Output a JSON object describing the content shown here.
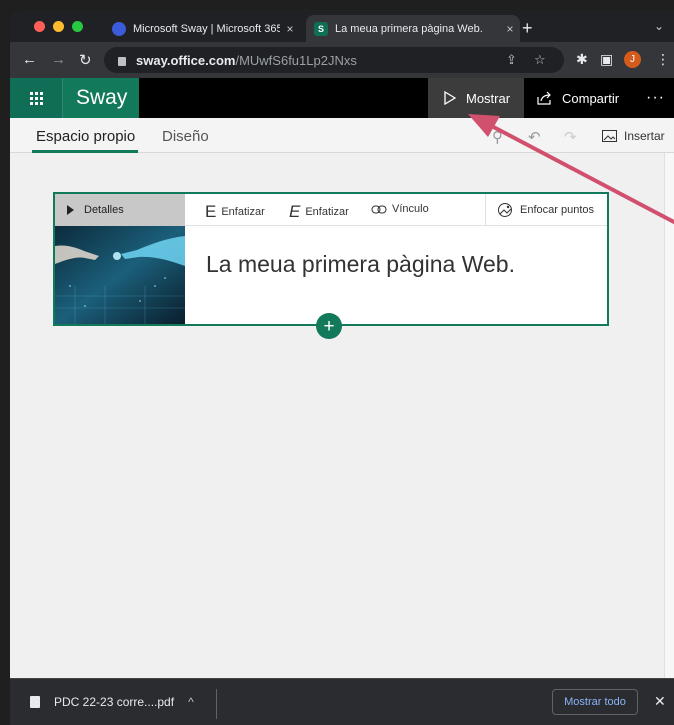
{
  "browser": {
    "tabs": [
      {
        "title": "Microsoft Sway | Microsoft 365",
        "favicon_color": "#3b5bdb"
      },
      {
        "title": "La meua primera pàgina Web.",
        "favicon": "S",
        "favicon_color": "#0f6e55",
        "active": true
      }
    ],
    "tab_close": "×",
    "new_tab": "+",
    "tab_menu": "⌄",
    "url_domain": "sway.office.com",
    "url_path": "/MUwfS6fu1Lp2JNxs",
    "profile_initial": "J"
  },
  "sway": {
    "brand": "Sway",
    "show_label": "Mostrar",
    "share_label": "Compartir",
    "more": "···",
    "tabs": [
      "Espacio propio",
      "Diseño"
    ],
    "insert_label": "Insertar",
    "accent": "#13795b"
  },
  "card": {
    "details_label": "Detalles",
    "emphasize_label_1": "Enfatizar",
    "emphasize_label_2": "Enfatizar",
    "link_label": "Vínculo",
    "focus_points_label": "Enfocar puntos",
    "title": "La meua primera pàgina Web."
  },
  "downloads": {
    "file": "PDC 22-23 corre....pdf",
    "show_all": "Mostrar todo",
    "close": "✕"
  },
  "annotation": {
    "arrow_color": "#d1506e"
  }
}
